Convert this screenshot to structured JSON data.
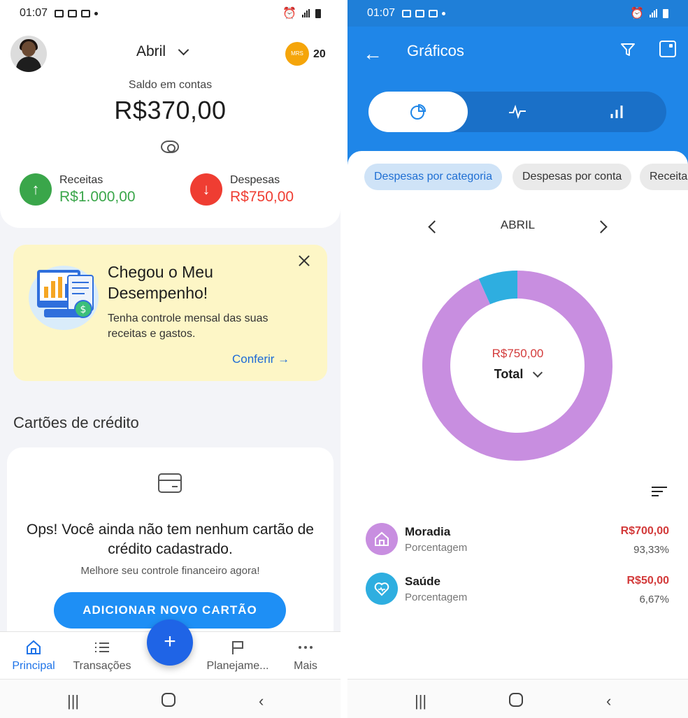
{
  "left": {
    "status": {
      "time": "01:07"
    },
    "header": {
      "month": "Abril",
      "badge_text": "MRS",
      "badge_count": "20",
      "saldo_label": "Saldo em contas",
      "saldo_value": "R$370,00"
    },
    "receitas": {
      "label": "Receitas",
      "value": "R$1.000,00"
    },
    "despesas": {
      "label": "Despesas",
      "value": "R$750,00"
    },
    "promo": {
      "title": "Chegou o Meu Desempenho!",
      "text": "Tenha controle mensal das suas receitas e gastos.",
      "link": "Conferir →"
    },
    "credit_cards": {
      "section_title": "Cartões de crédito",
      "empty_title": "Ops! Você ainda não tem nenhum cartão de crédito cadastrado.",
      "empty_sub": "Melhore seu controle financeiro agora!",
      "add_button": "ADICIONAR NOVO CARTÃO"
    },
    "nav": {
      "items": [
        {
          "label": "Principal"
        },
        {
          "label": "Transações"
        },
        {
          "label": "Planejame..."
        },
        {
          "label": "Mais"
        }
      ],
      "fab": "+"
    }
  },
  "right": {
    "status": {
      "time": "01:07"
    },
    "title": "Gráficos",
    "chips": [
      "Despesas por categoria",
      "Despesas por conta",
      "Receitas"
    ],
    "month": "ABRIL",
    "total_value": "R$750,00",
    "total_label": "Total",
    "donut": {
      "colors": {
        "moradia": "#c88ee0",
        "saude": "#2eaee0"
      },
      "values": [
        700,
        50
      ]
    },
    "categories": [
      {
        "name": "Moradia",
        "sub": "Porcentagem",
        "amount": "R$700,00",
        "percent": "93,33%"
      },
      {
        "name": "Saúde",
        "sub": "Porcentagem",
        "amount": "R$50,00",
        "percent": "6,67%"
      }
    ]
  },
  "colors": {
    "primary_blue": "#1f86e8",
    "income_green": "#3aa64a",
    "expense_red": "#ef3d32",
    "promo_bg": "#fdf6c6"
  }
}
